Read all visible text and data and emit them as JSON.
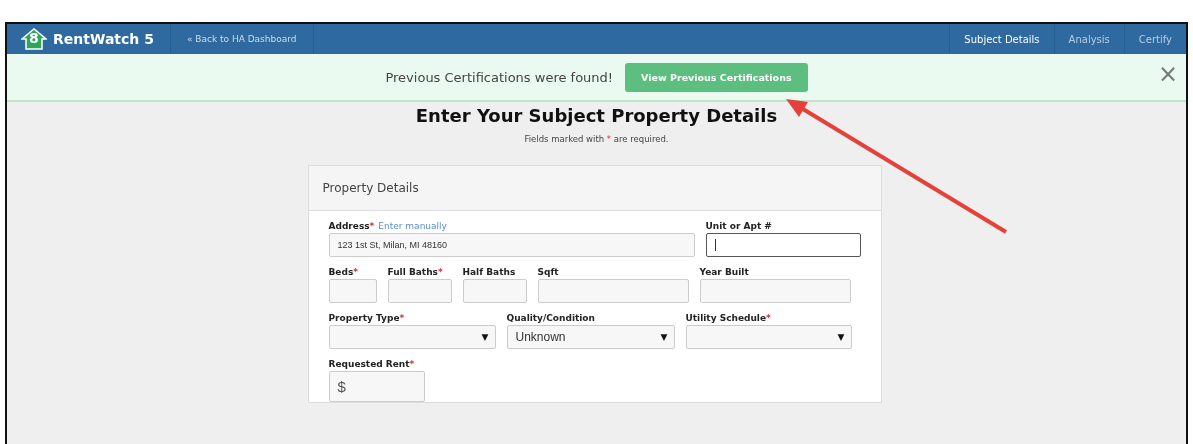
{
  "navbar": {
    "logo_digit": "8",
    "brand": "RentWatch 5",
    "back_link": "« Back to HA Dashboard",
    "tabs": [
      {
        "label": "Subject Details",
        "selected": true
      },
      {
        "label": "Analysis",
        "selected": false
      },
      {
        "label": "Certify",
        "selected": false
      }
    ]
  },
  "alert": {
    "message": "Previous Certifications were found!",
    "button": "View Previous Certifications",
    "close": "×"
  },
  "page": {
    "title": "Enter Your Subject Property Details",
    "note_before": "Fields marked with",
    "note_mark": "*",
    "note_after": "are required."
  },
  "card": {
    "title": "Property Details",
    "fields": [
      {
        "label": "Address",
        "mark": "*",
        "link": "Enter manually",
        "kind": "text",
        "value": "123 1st St, Milan, MI 48160"
      },
      {
        "label": "Unit or Apt #",
        "kind": "text",
        "focused": true
      },
      {
        "label": "Beds",
        "mark": "*",
        "kind": "text"
      },
      {
        "label": "Full Baths",
        "mark": "*",
        "kind": "text"
      },
      {
        "label": "Half Baths",
        "kind": "text"
      },
      {
        "label": "Sqft",
        "kind": "text"
      },
      {
        "label": "Year Built",
        "kind": "text"
      },
      {
        "label": "Property Type",
        "mark": "*",
        "kind": "select",
        "arrow": "▼"
      },
      {
        "label": "Quality/Condition",
        "kind": "select",
        "value": "Unknown",
        "arrow": "▼"
      },
      {
        "label": "Utility Schedule",
        "mark": "*",
        "kind": "select",
        "arrow": "▼"
      },
      {
        "label": "Requested Rent",
        "mark": "*",
        "kind": "money",
        "prefix": "$"
      }
    ]
  }
}
